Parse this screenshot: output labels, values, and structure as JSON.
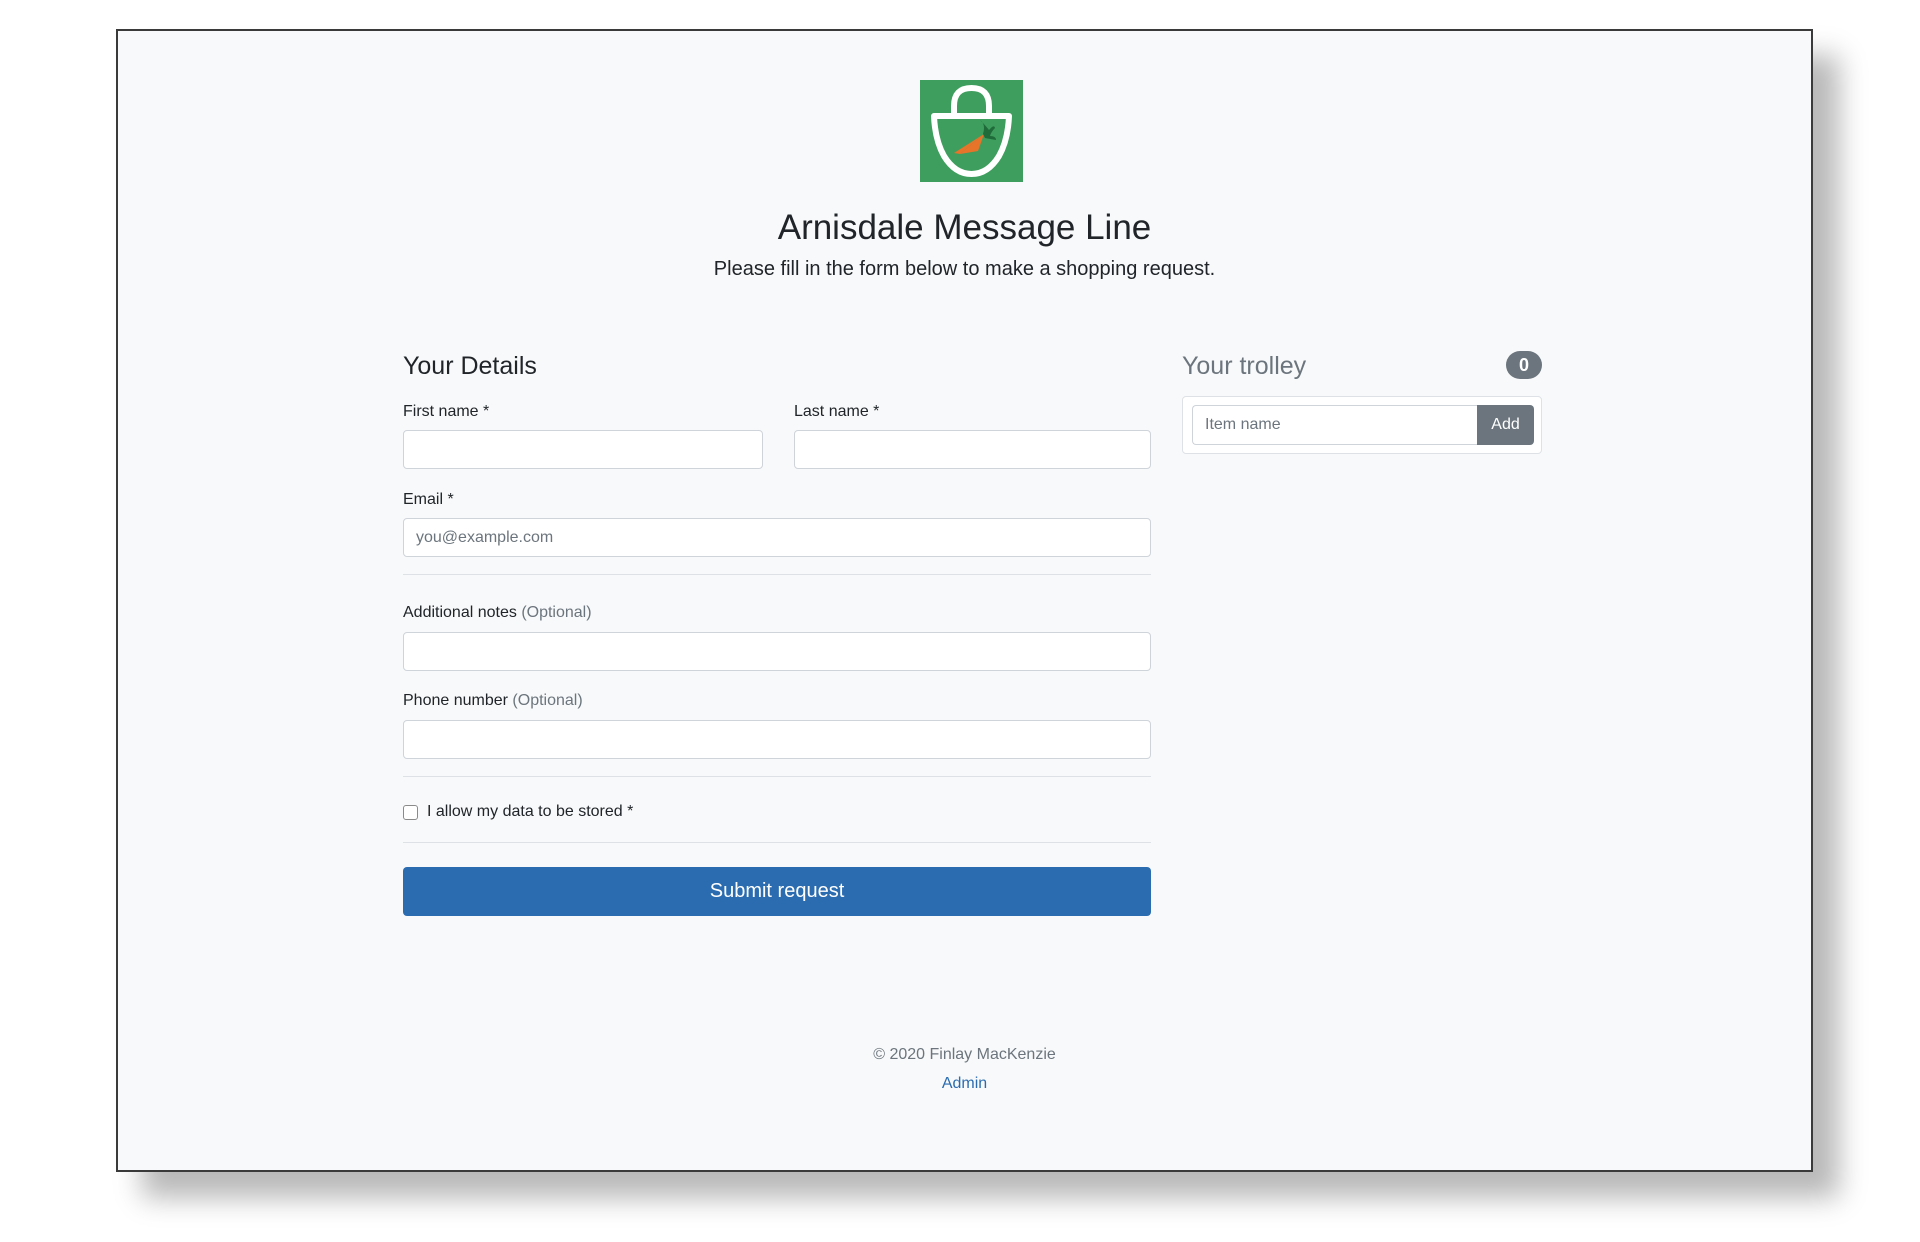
{
  "header": {
    "title": "Arnisdale Message Line",
    "subtitle": "Please fill in the form below to make a shopping request."
  },
  "details": {
    "heading": "Your Details",
    "first_name_label": "First name *",
    "last_name_label": "Last name *",
    "email_label": "Email *",
    "email_placeholder": "you@example.com",
    "notes_label": "Additional notes",
    "notes_optional": "(Optional)",
    "phone_label": "Phone number",
    "phone_optional": "(Optional)",
    "consent_label": "I allow my data to be stored *",
    "submit_label": "Submit request"
  },
  "trolley": {
    "heading": "Your trolley",
    "count": "0",
    "item_placeholder": "Item name",
    "add_label": "Add"
  },
  "footer": {
    "copyright": "© 2020 Finlay MacKenzie",
    "admin_link": "Admin"
  },
  "colors": {
    "logo_green": "#3e9e5d",
    "primary": "#2b6cb0",
    "secondary": "#6c757d",
    "carrot": "#e8742a",
    "carrot_leaf": "#1f6b3a"
  },
  "icons": {
    "logo": "shopping-basket-with-carrot-icon"
  }
}
